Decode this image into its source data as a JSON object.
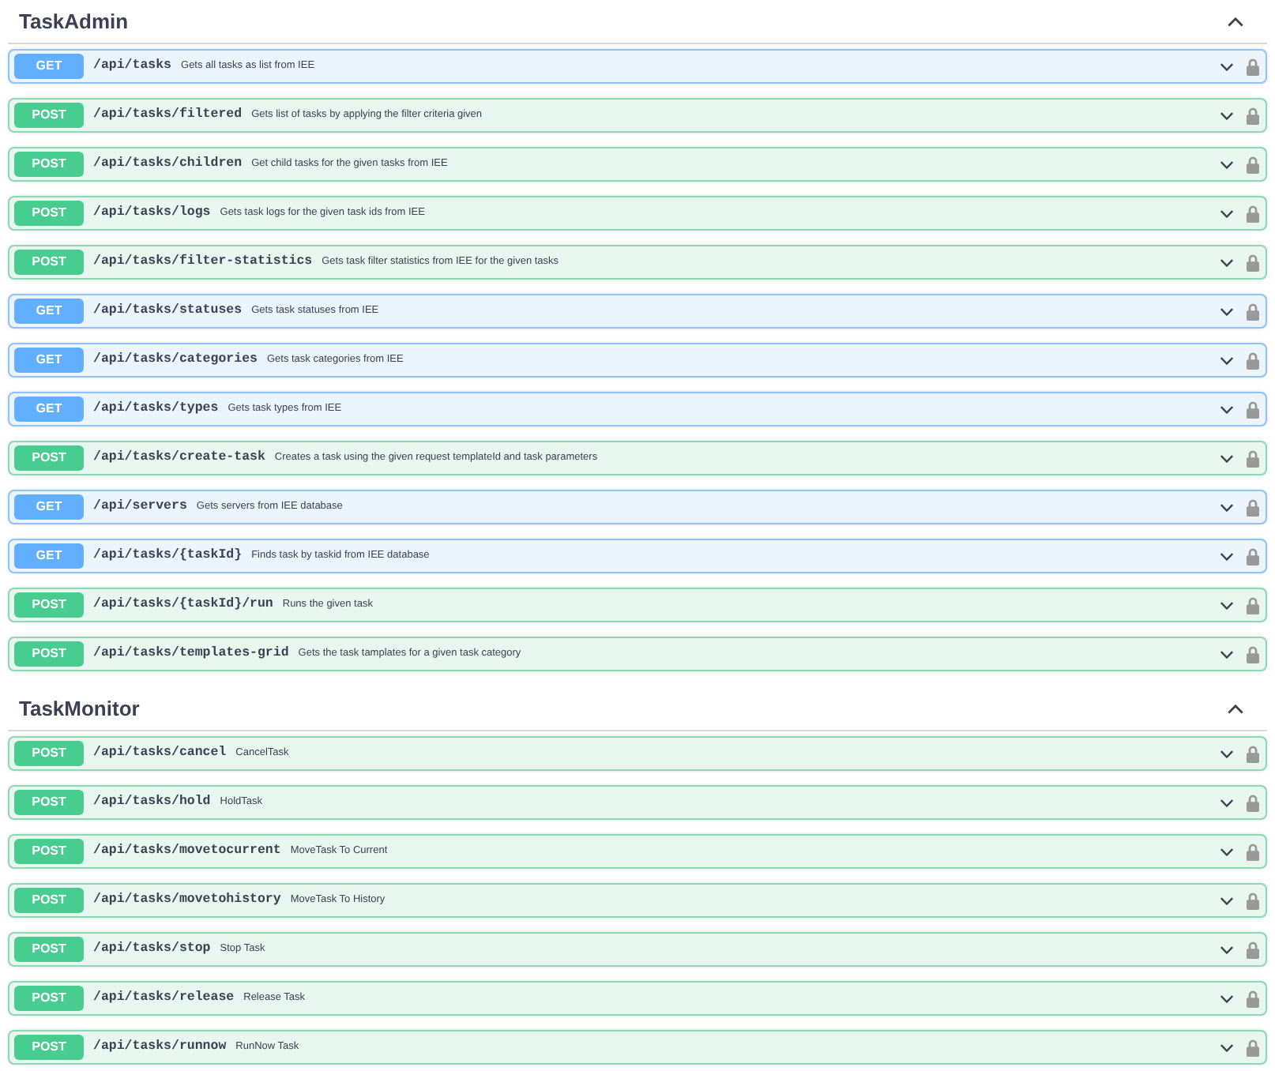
{
  "sections": [
    {
      "title": "TaskAdmin",
      "expanded": true,
      "operations": [
        {
          "kind": "get",
          "method": "GET",
          "path": "/api/tasks",
          "summary": "Gets all tasks as list from IEE",
          "expanded": false
        },
        {
          "kind": "post",
          "method": "POST",
          "path": "/api/tasks/filtered",
          "summary": "Gets list of tasks by applying the filter criteria given",
          "expanded": false
        },
        {
          "kind": "post",
          "method": "POST",
          "path": "/api/tasks/children",
          "summary": "Get child tasks for the given tasks from IEE",
          "expanded": false
        },
        {
          "kind": "post",
          "method": "POST",
          "path": "/api/tasks/logs",
          "summary": "Gets task logs for the given task ids from IEE",
          "expanded": false
        },
        {
          "kind": "post",
          "method": "POST",
          "path": "/api/tasks/filter-statistics",
          "summary": "Gets task filter statistics from IEE for the given tasks",
          "expanded": false
        },
        {
          "kind": "get",
          "method": "GET",
          "path": "/api/tasks/statuses",
          "summary": "Gets task statuses from IEE",
          "expanded": false
        },
        {
          "kind": "get",
          "method": "GET",
          "path": "/api/tasks/categories",
          "summary": "Gets task categories from IEE",
          "expanded": false
        },
        {
          "kind": "get",
          "method": "GET",
          "path": "/api/tasks/types",
          "summary": "Gets task types from IEE",
          "expanded": false
        },
        {
          "kind": "post",
          "method": "POST",
          "path": "/api/tasks/create-task",
          "summary": "Creates a task using the given request templateId and task parameters",
          "expanded": false
        },
        {
          "kind": "get",
          "method": "GET",
          "path": "/api/servers",
          "summary": "Gets servers from IEE database",
          "expanded": false
        },
        {
          "kind": "get",
          "method": "GET",
          "path": "/api/tasks/{taskId}",
          "summary": "Finds task by taskid from IEE database",
          "expanded": false
        },
        {
          "kind": "post",
          "method": "POST",
          "path": "/api/tasks/{taskId}/run",
          "summary": "Runs the given task",
          "expanded": false
        },
        {
          "kind": "post",
          "method": "POST",
          "path": "/api/tasks/templates-grid",
          "summary": "Gets the task tamplates for a given task category",
          "expanded": false
        }
      ]
    },
    {
      "title": "TaskMonitor",
      "expanded": true,
      "operations": [
        {
          "kind": "post",
          "method": "POST",
          "path": "/api/tasks/cancel",
          "summary": "CancelTask",
          "expanded": false
        },
        {
          "kind": "post",
          "method": "POST",
          "path": "/api/tasks/hold",
          "summary": "HoldTask",
          "expanded": false
        },
        {
          "kind": "post",
          "method": "POST",
          "path": "/api/tasks/movetocurrent",
          "summary": "MoveTask To Current",
          "expanded": false
        },
        {
          "kind": "post",
          "method": "POST",
          "path": "/api/tasks/movetohistory",
          "summary": "MoveTask To History",
          "expanded": false
        },
        {
          "kind": "post",
          "method": "POST",
          "path": "/api/tasks/stop",
          "summary": "Stop Task",
          "expanded": false
        },
        {
          "kind": "post",
          "method": "POST",
          "path": "/api/tasks/release",
          "summary": "Release Task",
          "expanded": false
        },
        {
          "kind": "post",
          "method": "POST",
          "path": "/api/tasks/runnow",
          "summary": "RunNow Task",
          "expanded": false
        }
      ]
    }
  ]
}
